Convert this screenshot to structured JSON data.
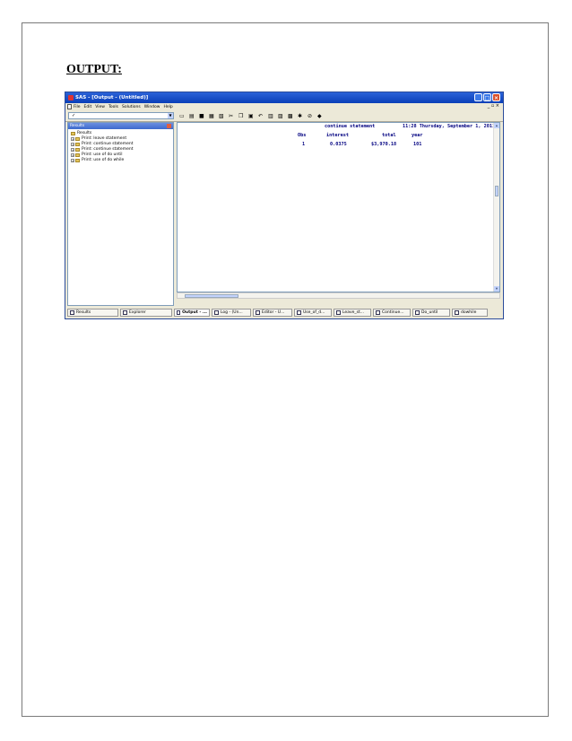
{
  "heading": "OUTPUT:",
  "window": {
    "title": "SAS - [Output - (Untitled)]",
    "menu": [
      "File",
      "Edit",
      "View",
      "Tools",
      "Solutions",
      "Window",
      "Help"
    ]
  },
  "results_panel": {
    "header": "Results",
    "root": "Results",
    "items": [
      "Print: leave statement",
      "Print: continue statement",
      "Print: continue statement",
      "Print: use of do until",
      "Print: use of do while"
    ]
  },
  "output": {
    "title_line": "continue statement",
    "timestamp": "11:28 Thursday, September 1, 2011",
    "columns": [
      "Obs",
      "interest",
      "total",
      "year"
    ],
    "rows": [
      [
        "1",
        "0.0375",
        "$3,970.18",
        "101"
      ]
    ]
  },
  "left_tabs": [
    "Results",
    "Explorer"
  ],
  "window_tabs": [
    "Output - ...",
    "Log - (Un...",
    "Editor - U...",
    "Use_of_d...",
    "Leave_st...",
    "Continue...",
    "Do_until",
    "dowhile"
  ]
}
